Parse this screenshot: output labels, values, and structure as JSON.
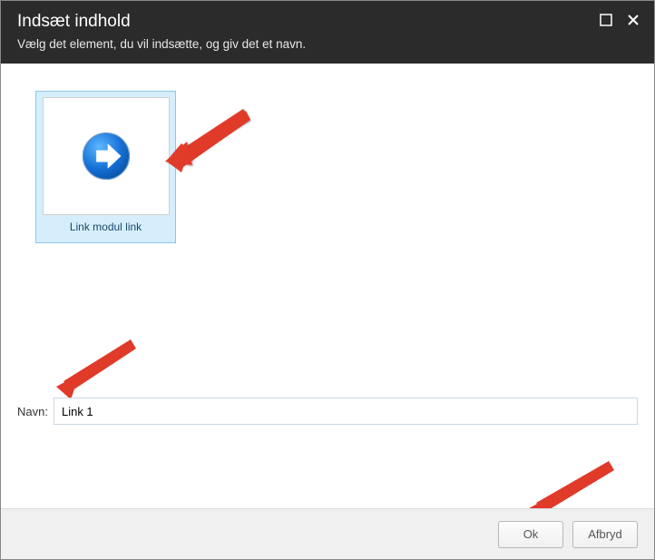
{
  "header": {
    "title": "Indsæt indhold",
    "subtitle": "Vælg det element, du vil indsætte, og giv det et navn."
  },
  "tile": {
    "label": "Link modul link"
  },
  "form": {
    "name_label": "Navn:",
    "name_value": "Link 1"
  },
  "footer": {
    "ok_label": "Ok",
    "cancel_label": "Afbryd"
  }
}
